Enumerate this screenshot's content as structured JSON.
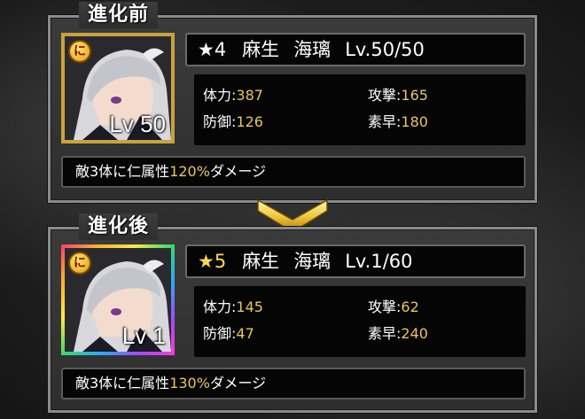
{
  "before": {
    "title": "進化前",
    "attribute_icon": "に",
    "level_display": "Lv 50",
    "rarity": "★4",
    "surname": "麻生",
    "given_name": "海璃",
    "level_text": "Lv.50/50",
    "stats": [
      {
        "label": "体力:",
        "value": "387"
      },
      {
        "label": "攻撃:",
        "value": "165"
      },
      {
        "label": "防御:",
        "value": "126"
      },
      {
        "label": "素早:",
        "value": "180"
      }
    ],
    "skill": {
      "prefix": "敵3体に仁属性",
      "percent": "120%",
      "suffix": "ダメージ"
    },
    "frame_color": "#c9a23a"
  },
  "after": {
    "title": "進化後",
    "attribute_icon": "に",
    "level_display": "Lv 1",
    "rarity": "★5",
    "surname": "麻生",
    "given_name": "海璃",
    "level_text": "Lv.1/60",
    "stats": [
      {
        "label": "体力:",
        "value": "145"
      },
      {
        "label": "攻撃:",
        "value": "62"
      },
      {
        "label": "防御:",
        "value": "47"
      },
      {
        "label": "素早:",
        "value": "240"
      }
    ],
    "skill": {
      "prefix": "敵3体に仁属性",
      "percent": "130%",
      "suffix": "ダメージ"
    },
    "frame_color": "rainbow"
  },
  "arrow_icon": "chevron-down-icon",
  "colors": {
    "value_gold": "#e7c65a",
    "star_gold": "#ffd84a",
    "panel_border": "#8a8a8a"
  }
}
